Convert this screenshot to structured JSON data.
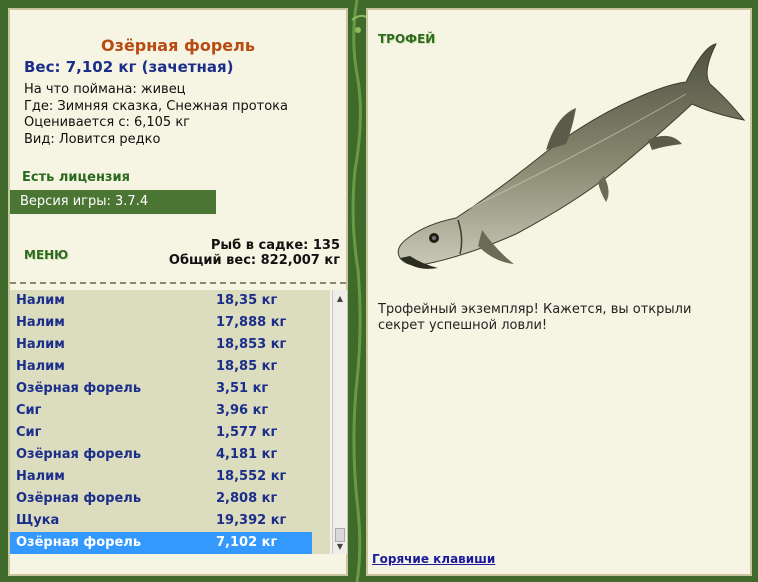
{
  "fish": {
    "title": "Озёрная форель",
    "weight": "Вес: 7,102 кг (зачетная)",
    "lines": [
      "На что поймана: живец",
      "Где: Зимняя сказка, Снежная протока",
      "Оценивается с: 6,105 кг",
      "Вид: Ловится редко"
    ]
  },
  "license": "Есть лицензия",
  "version": "Версия игры: 3.7.4",
  "menu_label": "МЕНЮ",
  "keep": {
    "count": "Рыб в садке: 135",
    "total": "Общий вес: 822,007 кг"
  },
  "catch_list": [
    {
      "name": "Налим",
      "weight": "18,35 кг"
    },
    {
      "name": "Налим",
      "weight": "17,888 кг"
    },
    {
      "name": "Налим",
      "weight": "18,853 кг"
    },
    {
      "name": "Налим",
      "weight": "18,85 кг"
    },
    {
      "name": "Озёрная форель",
      "weight": "3,51 кг"
    },
    {
      "name": "Сиг",
      "weight": "3,96 кг"
    },
    {
      "name": "Сиг",
      "weight": "1,577 кг"
    },
    {
      "name": "Озёрная форель",
      "weight": "4,181 кг"
    },
    {
      "name": "Налим",
      "weight": "18,552 кг"
    },
    {
      "name": "Озёрная форель",
      "weight": "2,808 кг"
    },
    {
      "name": "Щука",
      "weight": "19,392 кг"
    },
    {
      "name": "Озёрная форель",
      "weight": "7,102 кг"
    }
  ],
  "selected_index": 11,
  "trophy": {
    "label": "ТРОФЕЙ",
    "text": "Трофейный экземпляр! Кажется, вы открыли секрет успешной ловли!"
  },
  "hotkeys": "Горячие клавиши",
  "colors": {
    "accent": "#3399ff",
    "panel": "#f6f4e2",
    "frame": "#3f6a2b"
  }
}
